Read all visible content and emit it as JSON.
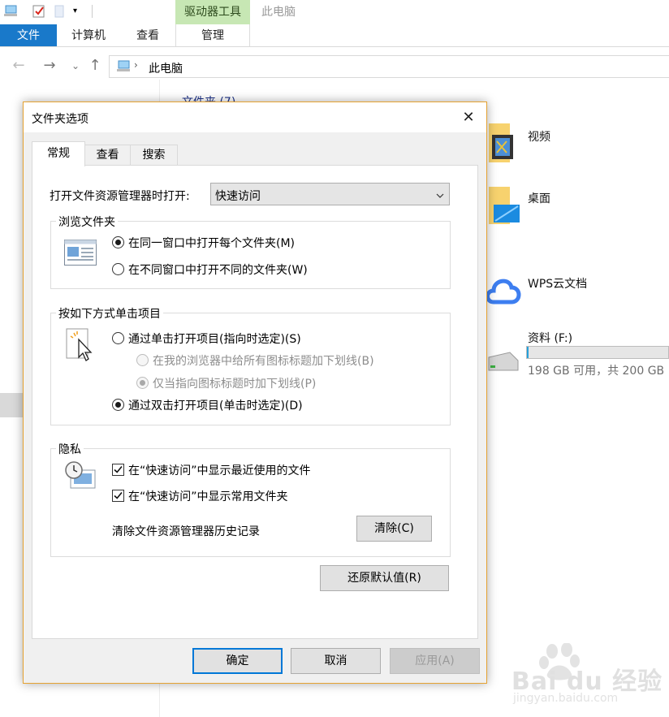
{
  "explorer": {
    "ribbon": {
      "context_tab": "驱动器工具",
      "window_title": "此电脑",
      "file_tab": "文件",
      "tabs": [
        "计算机",
        "查看"
      ],
      "manage_tab": "管理"
    },
    "address": {
      "path": "此电脑"
    },
    "group_header": "文件夹 (7)",
    "items": {
      "videos": "视频",
      "desktop": "桌面",
      "wps_cloud": "WPS云文档"
    },
    "drive": {
      "label": "资料 (F:)",
      "free_text": "198 GB 可用，共 200 GB",
      "used_fraction": 0.01
    }
  },
  "dialog": {
    "title": "文件夹选项",
    "tabs": [
      "常规",
      "查看",
      "搜索"
    ],
    "open_explorer_label": "打开文件资源管理器时打开:",
    "open_explorer_value": "快速访问",
    "browse": {
      "title": "浏览文件夹",
      "option_same_window": "在同一窗口中打开每个文件夹(M)",
      "option_new_window": "在不同窗口中打开不同的文件夹(W)"
    },
    "click": {
      "title": "按如下方式单击项目",
      "option_single": "通过单击打开项目(指向时选定)(S)",
      "option_underline_all": "在我的浏览器中给所有图标标题加下划线(B)",
      "option_underline_hover": "仅当指向图标标题时加下划线(P)",
      "option_double": "通过双击打开项目(单击时选定)(D)"
    },
    "privacy": {
      "title": "隐私",
      "check_recent": "在“快速访问”中显示最近使用的文件",
      "check_frequent": "在“快速访问”中显示常用文件夹",
      "clear_label": "清除文件资源管理器历史记录",
      "clear_button": "清除(C)"
    },
    "restore_button": "还原默认值(R)",
    "ok_button": "确定",
    "cancel_button": "取消",
    "apply_button": "应用(A)"
  },
  "watermark": {
    "brand": "Bai du 经验",
    "url": "jingyan.baidu.com"
  },
  "colors": {
    "accent": "#1979ca",
    "context_tab": "#c7e7b4",
    "dialog_border": "#e5a232",
    "default_button_border": "#0078d7",
    "drive_fill": "#26a0da"
  }
}
